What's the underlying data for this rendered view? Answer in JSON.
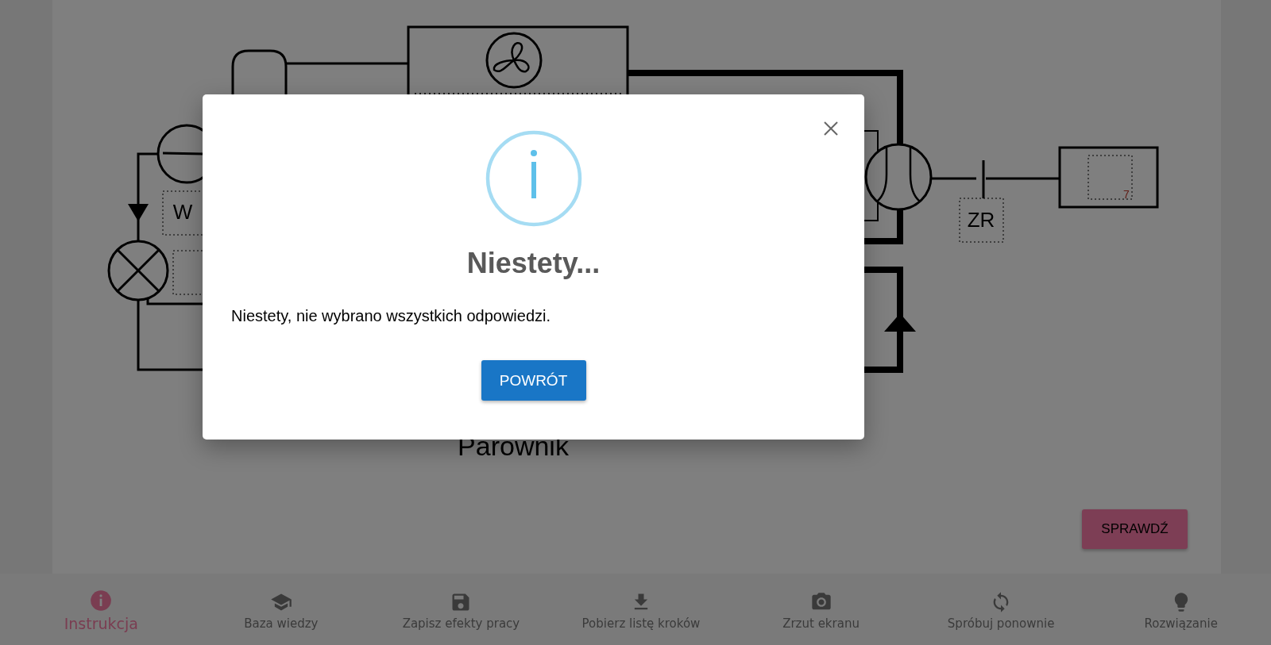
{
  "diagram": {
    "labels": [
      {
        "text": "W"
      },
      {
        "text": "ZR"
      },
      {
        "text": "7"
      },
      {
        "text": "Parownik"
      }
    ]
  },
  "check_button": {
    "label": "SPRAWDŹ"
  },
  "toolbar": {
    "items": [
      {
        "label": "Instrukcja",
        "selected": true
      },
      {
        "label": "Baza wiedzy",
        "selected": false
      },
      {
        "label": "Zapisz efekty pracy",
        "selected": false
      },
      {
        "label": "Pobierz listę kroków",
        "selected": false
      },
      {
        "label": "Zrzut ekranu",
        "selected": false
      },
      {
        "label": "Spróbuj ponownie",
        "selected": false
      },
      {
        "label": "Rozwiązanie",
        "selected": false
      }
    ]
  },
  "dialog": {
    "title": "Niestety...",
    "message": "Niestety, nie wybrano wszystkich odpowiedzi.",
    "button": "POWRÓT"
  }
}
